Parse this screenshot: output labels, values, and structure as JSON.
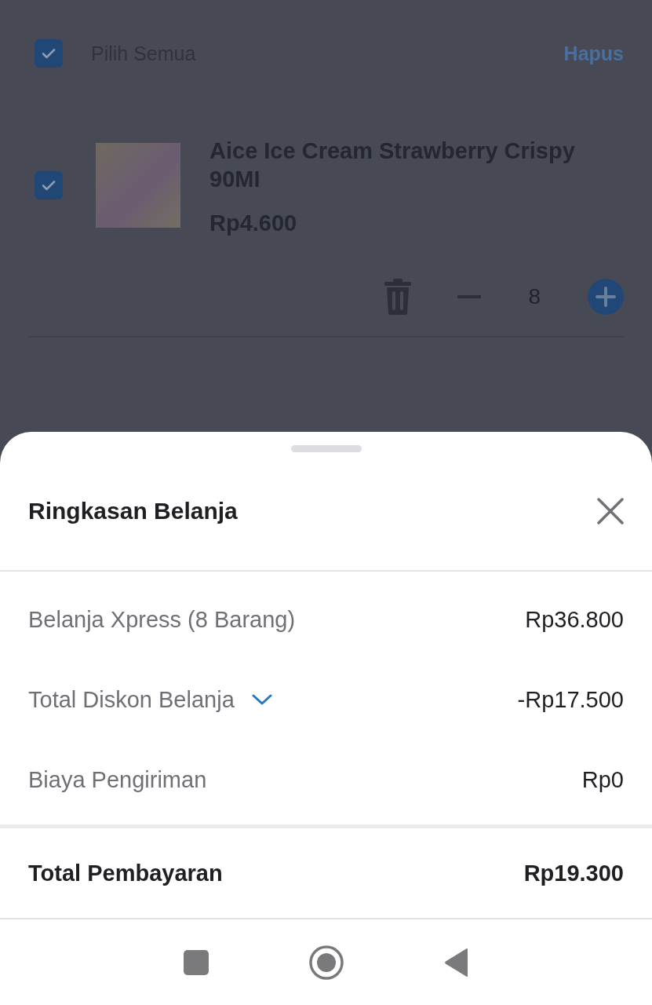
{
  "cart": {
    "select_all": {
      "label": "Pilih Semua",
      "checked": true
    },
    "delete_link": "Hapus",
    "items": [
      {
        "name": "Aice Ice Cream Strawberry Crispy 90MI",
        "price": "Rp4.600",
        "checked": true,
        "quantity": "8"
      }
    ]
  },
  "summary_sheet": {
    "title": "Ringkasan Belanja",
    "rows": [
      {
        "label": "Belanja Xpress (8 Barang)",
        "value": "Rp36.800",
        "expandable": false
      },
      {
        "label": "Total Diskon Belanja",
        "value": "-Rp17.500",
        "expandable": true
      },
      {
        "label": "Biaya Pengiriman",
        "value": "Rp0",
        "expandable": false
      }
    ],
    "total": {
      "label": "Total Pembayaran",
      "value": "Rp19.300"
    }
  }
}
